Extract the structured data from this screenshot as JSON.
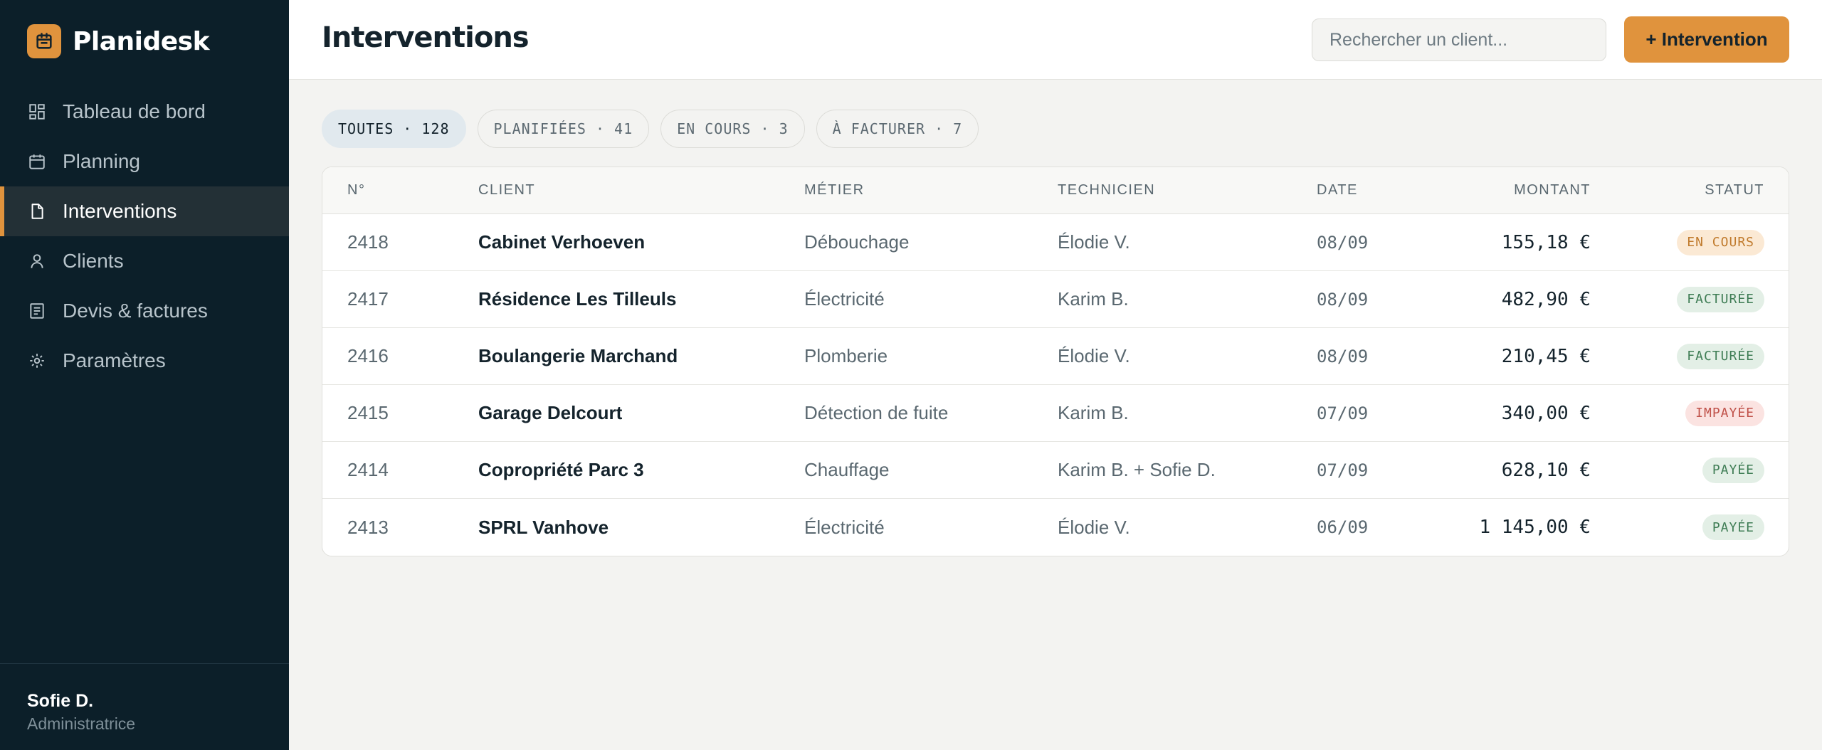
{
  "app": {
    "name": "Planidesk"
  },
  "sidebar": {
    "items": [
      {
        "label": "Tableau de bord",
        "icon": "dashboard-icon",
        "active": false
      },
      {
        "label": "Planning",
        "icon": "calendar-icon",
        "active": false
      },
      {
        "label": "Interventions",
        "icon": "document-icon",
        "active": true
      },
      {
        "label": "Clients",
        "icon": "user-icon",
        "active": false
      },
      {
        "label": "Devis & factures",
        "icon": "invoice-icon",
        "active": false
      },
      {
        "label": "Paramètres",
        "icon": "settings-icon",
        "active": false
      }
    ],
    "user": {
      "name": "Sofie D.",
      "role": "Administratrice"
    }
  },
  "header": {
    "title": "Interventions",
    "search_placeholder": "Rechercher un client...",
    "add_button": "+ Intervention"
  },
  "filters": [
    {
      "label": "TOUTES · 128",
      "active": true
    },
    {
      "label": "PLANIFIÉES · 41",
      "active": false
    },
    {
      "label": "EN COURS · 3",
      "active": false
    },
    {
      "label": "À FACTURER · 7",
      "active": false
    }
  ],
  "table": {
    "columns": {
      "num": "N°",
      "client": "CLIENT",
      "metier": "MÉTIER",
      "technicien": "TECHNICIEN",
      "date": "DATE",
      "montant": "MONTANT",
      "statut": "STATUT"
    },
    "rows": [
      {
        "num": "2418",
        "client": "Cabinet Verhoeven",
        "metier": "Débouchage",
        "technicien": "Élodie V.",
        "date": "08/09",
        "montant": "155,18 €",
        "statut": "EN COURS"
      },
      {
        "num": "2417",
        "client": "Résidence Les Tilleuls",
        "metier": "Électricité",
        "technicien": "Karim B.",
        "date": "08/09",
        "montant": "482,90 €",
        "statut": "FACTURÉE"
      },
      {
        "num": "2416",
        "client": "Boulangerie Marchand",
        "metier": "Plomberie",
        "technicien": "Élodie V.",
        "date": "08/09",
        "montant": "210,45 €",
        "statut": "FACTURÉE"
      },
      {
        "num": "2415",
        "client": "Garage Delcourt",
        "metier": "Détection de fuite",
        "technicien": "Karim B.",
        "date": "07/09",
        "montant": "340,00 €",
        "statut": "IMPAYÉE"
      },
      {
        "num": "2414",
        "client": "Copropriété Parc 3",
        "metier": "Chauffage",
        "technicien": "Karim B. + Sofie D.",
        "date": "07/09",
        "montant": "628,10 €",
        "statut": "PAYÉE"
      },
      {
        "num": "2413",
        "client": "SPRL Vanhove",
        "metier": "Électricité",
        "technicien": "Élodie V.",
        "date": "06/09",
        "montant": "1 145,00 €",
        "statut": "PAYÉE"
      }
    ]
  },
  "colors": {
    "accent": "#e0933d",
    "sidebar_bg": "#0c1f29",
    "status_encours": "#c07a2c",
    "status_facturee": "#3f7d55",
    "status_impayee": "#c0524a",
    "status_payee": "#3f7d55"
  }
}
